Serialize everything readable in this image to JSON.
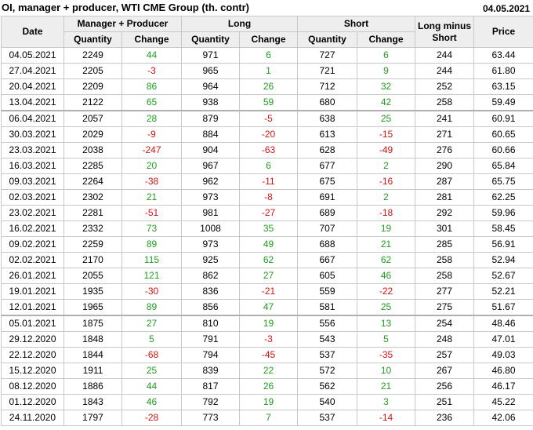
{
  "title": "OI, manager + producer, WTI CME Group (th. contr)",
  "date": "04.05.2021",
  "headers": {
    "date": "Date",
    "group_mp": "Manager + Producer",
    "group_long": "Long",
    "group_short": "Short",
    "long_minus_short": "Long minus Short",
    "price": "Price",
    "quantity": "Quantity",
    "change": "Change"
  },
  "colors": {
    "positive": "#1f9e1f",
    "negative": "#d01414",
    "header_bg": "#eeeeee"
  },
  "rows": [
    [
      "04.05.2021",
      "2249",
      "44",
      "971",
      "6",
      "727",
      "6",
      "244",
      "63.44"
    ],
    [
      "27.04.2021",
      "2205",
      "-3",
      "965",
      "1",
      "721",
      "9",
      "244",
      "61.80"
    ],
    [
      "20.04.2021",
      "2209",
      "86",
      "964",
      "26",
      "712",
      "32",
      "252",
      "63.15"
    ],
    [
      "13.04.2021",
      "2122",
      "65",
      "938",
      "59",
      "680",
      "42",
      "258",
      "59.49"
    ],
    [
      "06.04.2021",
      "2057",
      "28",
      "879",
      "-5",
      "638",
      "25",
      "241",
      "60.91"
    ],
    [
      "30.03.2021",
      "2029",
      "-9",
      "884",
      "-20",
      "613",
      "-15",
      "271",
      "60.65"
    ],
    [
      "23.03.2021",
      "2038",
      "-247",
      "904",
      "-63",
      "628",
      "-49",
      "276",
      "60.66"
    ],
    [
      "16.03.2021",
      "2285",
      "20",
      "967",
      "6",
      "677",
      "2",
      "290",
      "65.84"
    ],
    [
      "09.03.2021",
      "2264",
      "-38",
      "962",
      "-11",
      "675",
      "-16",
      "287",
      "65.75"
    ],
    [
      "02.03.2021",
      "2302",
      "21",
      "973",
      "-8",
      "691",
      "2",
      "281",
      "62.25"
    ],
    [
      "23.02.2021",
      "2281",
      "-51",
      "981",
      "-27",
      "689",
      "-18",
      "292",
      "59.96"
    ],
    [
      "16.02.2021",
      "2332",
      "73",
      "1008",
      "35",
      "707",
      "19",
      "301",
      "58.45"
    ],
    [
      "09.02.2021",
      "2259",
      "89",
      "973",
      "49",
      "688",
      "21",
      "285",
      "56.91"
    ],
    [
      "02.02.2021",
      "2170",
      "115",
      "925",
      "62",
      "667",
      "62",
      "258",
      "52.94"
    ],
    [
      "26.01.2021",
      "2055",
      "121",
      "862",
      "27",
      "605",
      "46",
      "258",
      "52.67"
    ],
    [
      "19.01.2021",
      "1935",
      "-30",
      "836",
      "-21",
      "559",
      "-22",
      "277",
      "52.21"
    ],
    [
      "12.01.2021",
      "1965",
      "89",
      "856",
      "47",
      "581",
      "25",
      "275",
      "51.67"
    ],
    [
      "05.01.2021",
      "1875",
      "27",
      "810",
      "19",
      "556",
      "13",
      "254",
      "48.46"
    ],
    [
      "29.12.2020",
      "1848",
      "5",
      "791",
      "-3",
      "543",
      "5",
      "248",
      "47.01"
    ],
    [
      "22.12.2020",
      "1844",
      "-68",
      "794",
      "-45",
      "537",
      "-35",
      "257",
      "49.03"
    ],
    [
      "15.12.2020",
      "1911",
      "25",
      "839",
      "22",
      "572",
      "10",
      "267",
      "46.80"
    ],
    [
      "08.12.2020",
      "1886",
      "44",
      "817",
      "26",
      "562",
      "21",
      "256",
      "46.17"
    ],
    [
      "01.12.2020",
      "1843",
      "46",
      "792",
      "19",
      "540",
      "3",
      "251",
      "45.22"
    ],
    [
      "24.11.2020",
      "1797",
      "-28",
      "773",
      "7",
      "537",
      "-14",
      "236",
      "42.06"
    ]
  ]
}
